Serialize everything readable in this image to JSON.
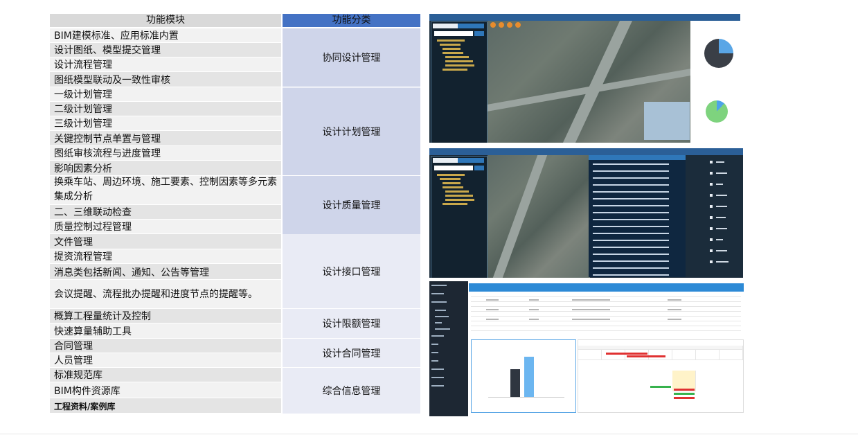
{
  "table": {
    "header_module": "功能模块",
    "header_category": "功能分类",
    "rows": [
      {
        "text": "BIM建模标准、应用标准内置"
      },
      {
        "text": "设计图纸、模型提交管理"
      },
      {
        "text": "设计流程管理"
      },
      {
        "text": "图纸模型联动及一致性审核"
      },
      {
        "text": "一级计划管理"
      },
      {
        "text": "二级计划管理"
      },
      {
        "text": "三级计划管理"
      },
      {
        "text": "关键控制节点单置与管理"
      },
      {
        "text": "图纸审核流程与进度管理"
      },
      {
        "text": "影响因素分析"
      },
      {
        "text": "换乘车站、周边环境、施工要素、控制因素等多元素集成分析"
      },
      {
        "text": "二、三维联动检查"
      },
      {
        "text": "质量控制过程管理"
      },
      {
        "text": "文件管理"
      },
      {
        "text": "提资流程管理"
      },
      {
        "text": "消息类包括新闻、通知、公告等管理"
      },
      {
        "text": "会议提醒、流程批办提醒和进度节点的提醒等。"
      },
      {
        "text": "概算工程量统计及控制"
      },
      {
        "text": "快速算量辅助工具"
      },
      {
        "text": "合同管理"
      },
      {
        "text": "人员管理"
      },
      {
        "text": "标准规范库"
      },
      {
        "text": "BIM构件资源库"
      },
      {
        "text": "工程资料/案例库"
      }
    ],
    "categories": [
      {
        "label": "协同设计管理"
      },
      {
        "label": "设计计划管理"
      },
      {
        "label": "设计质量管理"
      },
      {
        "label": "设计接口管理"
      },
      {
        "label": "设计限额管理"
      },
      {
        "label": "设计合同管理"
      },
      {
        "label": "综合信息管理"
      }
    ]
  },
  "icons": {
    "tool": "toolbar-icon",
    "menu": "menu-item-icon"
  },
  "colors": {
    "header_category": "#4472c4",
    "category_dark": "#cfd5ea",
    "category_light": "#e9ebf5",
    "row_gray": "#f2f2f2",
    "row_gray_alt": "#e4e4e4"
  }
}
